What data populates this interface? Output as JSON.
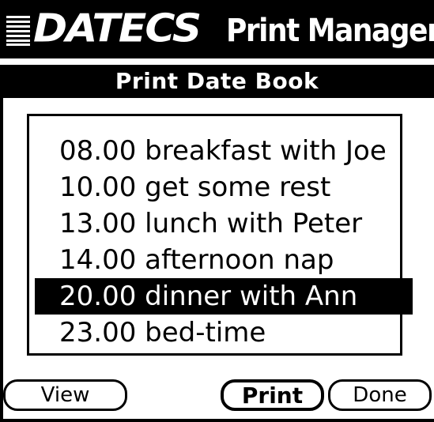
{
  "brand": {
    "company": "DATECS",
    "product": "Print Manager",
    "logo_icon": "striped-square-icon"
  },
  "dialog": {
    "title": "Print Date Book"
  },
  "date_book": {
    "selected_index": 4,
    "entries": [
      {
        "label": "08.00 breakfast with Joe"
      },
      {
        "label": "10.00 get some rest"
      },
      {
        "label": "13.00 lunch with Peter"
      },
      {
        "label": "14.00 afternoon nap"
      },
      {
        "label": "20.00 dinner with Ann"
      },
      {
        "label": "23.00 bed-time"
      }
    ]
  },
  "buttons": {
    "view": "View",
    "print": "Print",
    "done": "Done"
  },
  "colors": {
    "foreground": "#000000",
    "background": "#ffffff"
  }
}
